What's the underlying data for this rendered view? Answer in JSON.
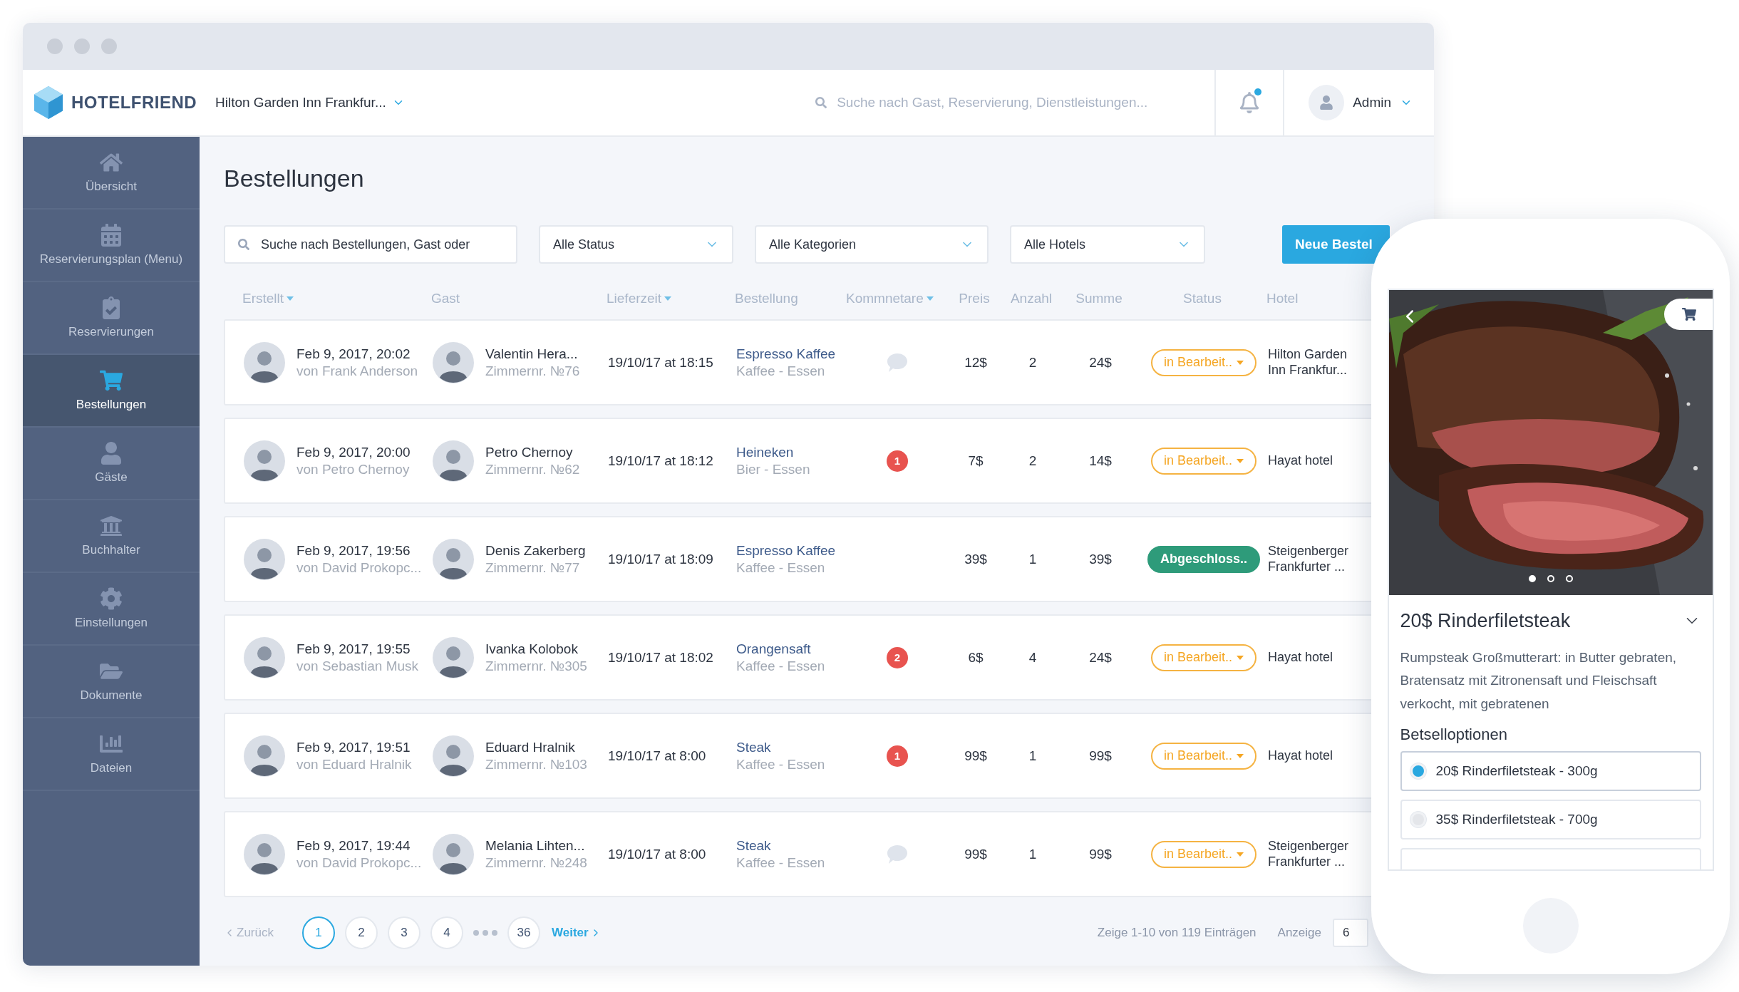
{
  "brand": {
    "name": "HOTELFRIEND"
  },
  "header": {
    "hotel_selector": "Hilton Garden Inn Frankfur...",
    "search": {
      "placeholder": "Suche nach Gast, Reservierung, Dienstleistungen..."
    },
    "notifications": {
      "unread": true
    },
    "user": {
      "name": "Admin"
    }
  },
  "sidebar": {
    "items": [
      {
        "label": "Übersicht",
        "selected": false
      },
      {
        "label": "Reservierungsplan (Menu)",
        "selected": false
      },
      {
        "label": "Reservierungen",
        "selected": false
      },
      {
        "label": "Bestellungen",
        "selected": true
      },
      {
        "label": "Gäste",
        "selected": false
      },
      {
        "label": "Buchhalter",
        "selected": false
      },
      {
        "label": "Einstellungen",
        "selected": false
      },
      {
        "label": "Dokumente",
        "selected": false
      },
      {
        "label": "Dateien",
        "selected": false
      }
    ]
  },
  "page": {
    "title": "Bestellungen"
  },
  "filters": {
    "search": {
      "placeholder": "Suche nach Bestellungen, Gast oder"
    },
    "selects": [
      "Alle Status",
      "Alle Kategorien",
      "Alle Hotels"
    ],
    "new_button": "Neue Bestel"
  },
  "table": {
    "columns": [
      {
        "label": "Erstellt",
        "sortable": true
      },
      {
        "label": "Gast",
        "sortable": false
      },
      {
        "label": "Lieferzeit",
        "sortable": true
      },
      {
        "label": "Bestellung",
        "sortable": false
      },
      {
        "label": "Kommnetare",
        "sortable": true
      },
      {
        "label": "Preis",
        "sortable": false
      },
      {
        "label": "Anzahl",
        "sortable": false
      },
      {
        "label": "Summe",
        "sortable": false
      },
      {
        "label": "Status",
        "sortable": false
      },
      {
        "label": "Hotel",
        "sortable": false
      }
    ],
    "rows": [
      {
        "created": "Feb 9, 2017, 20:02",
        "created_by": "von Frank Anderson",
        "guest": "Valentin Hera...",
        "room": "Zimmernr. №76",
        "delivery": "19/10/17 at 18:15",
        "item": "Espresso Kaffee",
        "category": "Kaffee - Essen",
        "comments": {
          "kind": "empty"
        },
        "price": "12$",
        "quantity": "2",
        "total": "24$",
        "status": {
          "label": "in Bearbeit..",
          "kind": "processing"
        },
        "hotel": "Hilton Garden Inn Frankfur..."
      },
      {
        "created": "Feb 9, 2017, 20:00",
        "created_by": "von Petro Chernoy",
        "guest": "Petro Chernoy",
        "room": "Zimmernr. №62",
        "delivery": "19/10/17 at 18:12",
        "item": "Heineken",
        "category": "Bier - Essen",
        "comments": {
          "kind": "count",
          "count": "1"
        },
        "price": "7$",
        "quantity": "2",
        "total": "14$",
        "status": {
          "label": "in Bearbeit..",
          "kind": "processing"
        },
        "hotel": "Hayat hotel"
      },
      {
        "created": "Feb 9, 2017, 19:56",
        "created_by": "von David Prokopc...",
        "guest": "Denis Zakerberg",
        "room": "Zimmernr. №77",
        "delivery": "19/10/17 at 18:09",
        "item": "Espresso Kaffee",
        "category": "Kaffee - Essen",
        "price": "39$",
        "quantity": "1",
        "total": "39$",
        "status": {
          "label": "Abgeschloss..",
          "kind": "completed"
        },
        "hotel": "Steigenberger Frankfurter ..."
      },
      {
        "created": "Feb 9, 2017, 19:55",
        "created_by": "von Sebastian Musk",
        "guest": "Ivanka Kolobok",
        "room": "Zimmernr. №305",
        "delivery": "19/10/17 at 18:02",
        "item": "Orangensaft",
        "category": "Kaffee - Essen",
        "comments": {
          "kind": "count",
          "count": "2"
        },
        "price": "6$",
        "quantity": "4",
        "total": "24$",
        "status": {
          "label": "in Bearbeit..",
          "kind": "processing"
        },
        "hotel": "Hayat hotel"
      },
      {
        "created": "Feb 9, 2017, 19:51",
        "created_by": "von Eduard Hralnik",
        "guest": "Eduard Hralnik",
        "room": "Zimmernr. №103",
        "delivery": "19/10/17 at 8:00",
        "item": "Steak",
        "category": "Kaffee - Essen",
        "comments": {
          "kind": "count",
          "count": "1"
        },
        "price": "99$",
        "quantity": "1",
        "total": "99$",
        "status": {
          "label": "in Bearbeit..",
          "kind": "processing"
        },
        "hotel": "Hayat hotel"
      },
      {
        "created": "Feb 9, 2017, 19:44",
        "created_by": "von David Prokopc...",
        "guest": "Melania Lihten...",
        "room": "Zimmernr. №248",
        "delivery": "19/10/17 at 8:00",
        "item": "Steak",
        "category": "Kaffee - Essen",
        "comments": {
          "kind": "empty"
        },
        "price": "99$",
        "quantity": "1",
        "total": "99$",
        "status": {
          "label": "in Bearbeit..",
          "kind": "processing"
        },
        "hotel": "Steigenberger Frankfurter ..."
      }
    ]
  },
  "pagination": {
    "prev": "Zurück",
    "pages": [
      {
        "kind": "page",
        "label": "1",
        "selected": true
      },
      {
        "kind": "page",
        "label": "2",
        "selected": false
      },
      {
        "kind": "page",
        "label": "3",
        "selected": false
      },
      {
        "kind": "page",
        "label": "4",
        "selected": false
      },
      {
        "kind": "ellipsis"
      },
      {
        "kind": "page",
        "label": "36",
        "selected": false
      }
    ],
    "next": "Weiter",
    "summary": "Zeige 1-10 von 119 Einträgen",
    "page_size_label": "Anzeige",
    "page_size": "6"
  },
  "product_preview": {
    "carousel": [
      {
        "selected": true
      },
      {
        "selected": false
      },
      {
        "selected": false
      }
    ],
    "title": "20$ Rinderfiletsteak",
    "description": "Rumpsteak Großmutterart: in Butter gebraten, Bratensatz mit Zitronensaft und Fleischsaft verkocht, mit gebratenen",
    "options_title": "Betselloptionen",
    "options": [
      {
        "label": "20$ Rinderfiletsteak - 300g",
        "selected": true
      },
      {
        "label": "35$ Rinderfiletsteak - 700g",
        "selected": false
      }
    ]
  }
}
